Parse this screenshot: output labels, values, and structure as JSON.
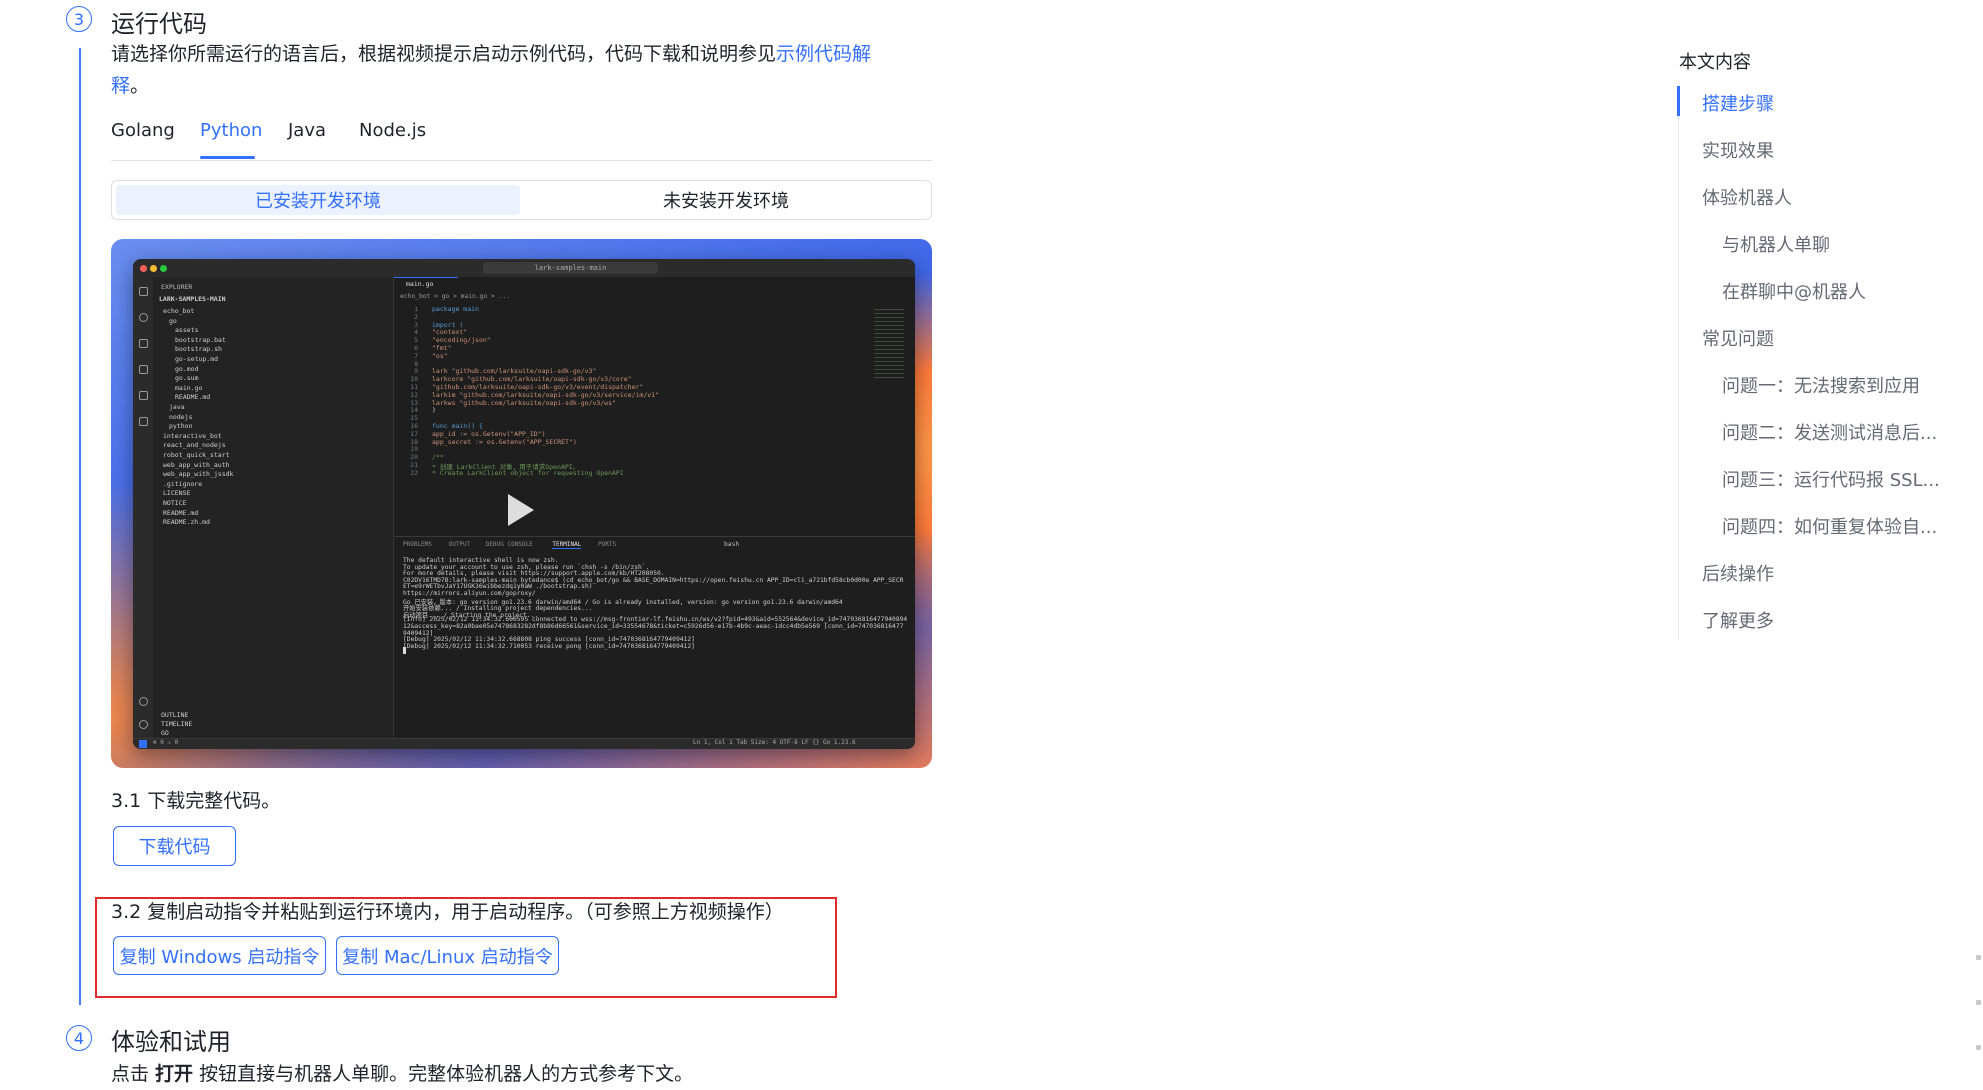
{
  "step3": {
    "number": "3",
    "title": "运行代码",
    "desc_line1": "请选择你所需运行的语言后，根据视频提示启动示例代码，代码下载和说明参见",
    "desc_link_part1": "示例代码解",
    "desc_link_part2": "释",
    "desc_end": "。"
  },
  "language_tabs": [
    {
      "label": "Golang"
    },
    {
      "label": "Python"
    },
    {
      "label": "Java"
    },
    {
      "label": "Node.js"
    }
  ],
  "env_segment": [
    {
      "label": "已安装开发环境"
    },
    {
      "label": "未安装开发环境"
    }
  ],
  "video": {
    "window_title": "lark-samples-main",
    "explorer": {
      "header": "EXPLORER",
      "root": "LARK-SAMPLES-MAIN",
      "items": [
        "echo_bot",
        "go",
        "assets",
        "bootstrap.bat",
        "bootstrap.sh",
        "go-setup.md",
        "go.mod",
        "go.sum",
        "main.go",
        "README.md",
        "java",
        "nodejs",
        "python",
        "interactive_bot",
        "react_and_nodejs",
        "robot_quick_start",
        "web_app_with_auth",
        "web_app_with_jssdk",
        ".gitignore",
        "LICENSE",
        "NOTICE",
        "README.md",
        "README.zh.md"
      ],
      "bottom": [
        "OUTLINE",
        "TIMELINE",
        "GO"
      ]
    },
    "editor_tab": "main.go",
    "breadcrumb": "echo_bot > go > main.go > ...",
    "code": [
      "package main",
      "",
      "import (",
      "    \"context\"",
      "    \"encoding/json\"",
      "    \"fmt\"",
      "    \"os\"",
      "",
      "    lark \"github.com/larksuite/oapi-sdk-go/v3\"",
      "    larkcore \"github.com/larksuite/oapi-sdk-go/v3/core\"",
      "    \"github.com/larksuite/oapi-sdk-go/v3/event/dispatcher\"",
      "    larkim \"github.com/larksuite/oapi-sdk-go/v3/service/im/v1\"",
      "    larkws \"github.com/larksuite/oapi-sdk-go/v3/ws\"",
      ")",
      "",
      "func main() {",
      "    app_id := os.Getenv(\"APP_ID\")",
      "    app_secret := os.Getenv(\"APP_SECRET\")",
      "",
      "    /**",
      "     * 创建 LarkClient 对象，用于请求OpenAPI。",
      "     * Create LarkClient object for requesting OpenAPI"
    ],
    "panel_tabs": [
      "PROBLEMS",
      "OUTPUT",
      "DEBUG CONSOLE",
      "TERMINAL",
      "PORTS"
    ],
    "terminal": [
      "The default interactive shell is now zsh.",
      "To update your account to use zsh, please run `chsh -s /bin/zsh`.",
      "For more details, please visit https://support.apple.com/kb/HT208050.",
      "C02DV16TMD7B:lark-samples-main bytedance$ (cd echo_bot/go && BASE_DOMAIN=https://open.feishu.cn APP_ID=cli_a721bfd58cb0d00e APP_SECR",
      "ET=e9rWETbvJaY17UGK36wibbezdq1y0aW  ./bootstrap.sh)",
      "https://mirrors.aliyun.com/goproxy/",
      "Go 已安装，版本: go version go1.23.6 darwin/amd64 / Go is already installed, version: go version go1.23.6 darwin/amd64",
      "开始安装依赖... / Installing project dependencies...",
      "启动项目... / Starting the project...",
      "[Info] 2025/02/12 11:34:32.660595 connected to wss://msg-frontier-lf.feishu.cn/ws/v2?fpid=493&aid=552564&device_id=747036816477940894",
      "12&access_key=82a0bae05e7478683282df8b86d66561&service_id=33554678&ticket=c5926d56-e17b-4b9c-aeac-1dcc4db5e569 [conn_id=747036816477",
      "9409412]",
      "[Debug] 2025/02/12 11:34:32.668808 ping success [conn_id=7470368164779409412]",
      "[Debug] 2025/02/12 11:34:32.710053 receive pong [conn_id=7470368164779409412]"
    ],
    "shell_label": "bash",
    "status_left": "⊗ 0 ⚠ 0",
    "status_right": "Ln 1, Col 1   Tab Size: 4   UTF-8   LF   {} Go   1.23.6"
  },
  "step31": {
    "text": "3.1 下载完整代码。",
    "button": "下载代码"
  },
  "step32": {
    "text": "3.2 复制启动指令并粘贴到运行环境内，用于启动程序。（可参照上方视频操作）",
    "button_windows": "复制 Windows 启动指令",
    "button_mac": "复制 Mac/Linux 启动指令"
  },
  "step4": {
    "number": "4",
    "title": "体验和试用",
    "desc_prefix": "点击 ",
    "desc_bold": "打开",
    "desc_suffix": " 按钮直接与机器人单聊。完整体验机器人的方式参考下文。"
  },
  "toc": {
    "title": "本文内容",
    "items": [
      {
        "label": "搭建步骤",
        "level": 1,
        "active": true
      },
      {
        "label": "实现效果",
        "level": 1
      },
      {
        "label": "体验机器人",
        "level": 1
      },
      {
        "label": "与机器人单聊",
        "level": 2
      },
      {
        "label": "在群聊中@机器人",
        "level": 2
      },
      {
        "label": "常见问题",
        "level": 1
      },
      {
        "label": "问题一：无法搜索到应用",
        "level": 2
      },
      {
        "label": "问题二：发送测试消息后...",
        "level": 2
      },
      {
        "label": "问题三：运行代码报 SSL...",
        "level": 2
      },
      {
        "label": "问题四：如何重复体验自...",
        "level": 2
      },
      {
        "label": "后续操作",
        "level": 1
      },
      {
        "label": "了解更多",
        "level": 1
      }
    ]
  },
  "colors": {
    "accent": "#3370ff",
    "highlight_box": "#e02a2a"
  }
}
